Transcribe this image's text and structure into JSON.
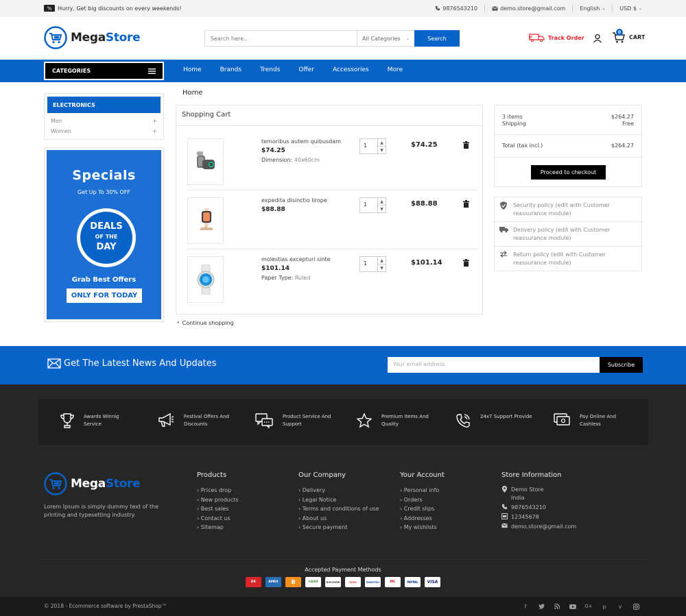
{
  "topbar": {
    "promo": "Hurry, Get big discounts on every weekends!",
    "phone": "9876543210",
    "email": "demo.store@gmail.com",
    "language": "English",
    "currency": "USD $"
  },
  "header": {
    "logo_a": "Mega",
    "logo_b": "Store",
    "search_placeholder": "Search here...",
    "search_category": "All Categories",
    "search_button": "Search",
    "track_order": "Track Order",
    "cart_label": "CART",
    "cart_count": "0"
  },
  "nav": {
    "categories_label": "CATEGORIES",
    "items": [
      "Home",
      "Brands",
      "Trends",
      "Offer",
      "Accessories",
      "More"
    ]
  },
  "sidebar": {
    "heading": "ELECTRONICS",
    "items": [
      {
        "label": "Men",
        "toggle": "+"
      },
      {
        "label": "Women",
        "toggle": "+"
      }
    ],
    "banner": {
      "title": "Specials",
      "subtitle": "Get Up To 30% OFF",
      "deal_1": "DEALS",
      "deal_2": "OF THE",
      "deal_3": "DAY",
      "grab": "Grab Best Offers",
      "cta": "ONLY FOR TODAY"
    }
  },
  "breadcrumb": "Home",
  "cart": {
    "title": "Shopping Cart",
    "items": [
      {
        "name": "temoribus autem quibusdam",
        "price": "$74.25",
        "attr_label": "Dimension:",
        "attr_value": "40x60cm",
        "qty": "1",
        "total": "$74.25"
      },
      {
        "name": "expedita disinctio lirope",
        "price": "$88.88",
        "attr_label": "",
        "attr_value": "",
        "qty": "1",
        "total": "$88.88"
      },
      {
        "name": "molestias excepturi sinte",
        "price": "$101.14",
        "attr_label": "Paper Type:",
        "attr_value": "Ruled",
        "qty": "1",
        "total": "$101.14"
      }
    ],
    "continue": "Continue shopping"
  },
  "summary": {
    "items_label": "3 items",
    "items_value": "$264.27",
    "shipping_label": "Shipping",
    "shipping_value": "Free",
    "total_label": "Total (tax incl.)",
    "total_value": "$264.27",
    "checkout": "Proceed to checkout"
  },
  "reassurance": [
    {
      "icon": "shield-icon",
      "text": "Security policy (edit with Customer reassurance module)"
    },
    {
      "icon": "truck-icon",
      "text": "Delivery policy (edit with Customer reassurance module)"
    },
    {
      "icon": "return-icon",
      "text": "Return policy (edit with Customer reassurance module)"
    }
  ],
  "newsletter": {
    "title": "Get The Latest News And Updates",
    "placeholder": "Your email address",
    "button": "Subscribe"
  },
  "features": [
    {
      "icon": "trophy-icon",
      "line1": "Awards Winnig",
      "line2": "Service"
    },
    {
      "icon": "megaphone-icon",
      "line1": "Festival Offers And",
      "line2": "Discounts"
    },
    {
      "icon": "chat-icon",
      "line1": "Product Service And",
      "line2": "Support"
    },
    {
      "icon": "star-icon",
      "line1": "Premium Items And",
      "line2": "Quality"
    },
    {
      "icon": "phone-support-icon",
      "line1": "24x7 Support Provide",
      "line2": ""
    },
    {
      "icon": "payment-icon",
      "line1": "Pay Online And",
      "line2": "Cashless"
    }
  ],
  "footer": {
    "description": "Lorem Ipsum is simply dummy text of the printing and typesetting industry.",
    "products": {
      "title": "Products",
      "links": [
        "Prices drop",
        "New products",
        "Best sales",
        "Contact us",
        "Sitemap"
      ]
    },
    "company": {
      "title": "Our Company",
      "links": [
        "Delivery",
        "Legal Notice",
        "Terms and conditions of use",
        "About us",
        "Secure payment"
      ]
    },
    "account": {
      "title": "Your Account",
      "links": [
        "Personal info",
        "Orders",
        "Credit slips",
        "Addresses",
        "My wishlists"
      ]
    },
    "store": {
      "title": "Store Information",
      "name": "Demo Store",
      "country": "India",
      "phone": "9876543210",
      "fax": "12345678",
      "email": "demo.store@gmail.com"
    },
    "payment_title": "Accepted Payment Methods",
    "payment_cards": [
      "DK",
      "AMEX",
      "B",
      "CASH",
      "DISCOVER",
      "GPAY",
      "MAESTRO",
      "MC",
      "PAYPAL",
      "VISA"
    ],
    "copyright": "© 2018 - Ecommerce software by PrestaShop™"
  },
  "colors": {
    "brand": "#0a63c9",
    "accent_red": "#e4242b",
    "dark": "#262626"
  }
}
